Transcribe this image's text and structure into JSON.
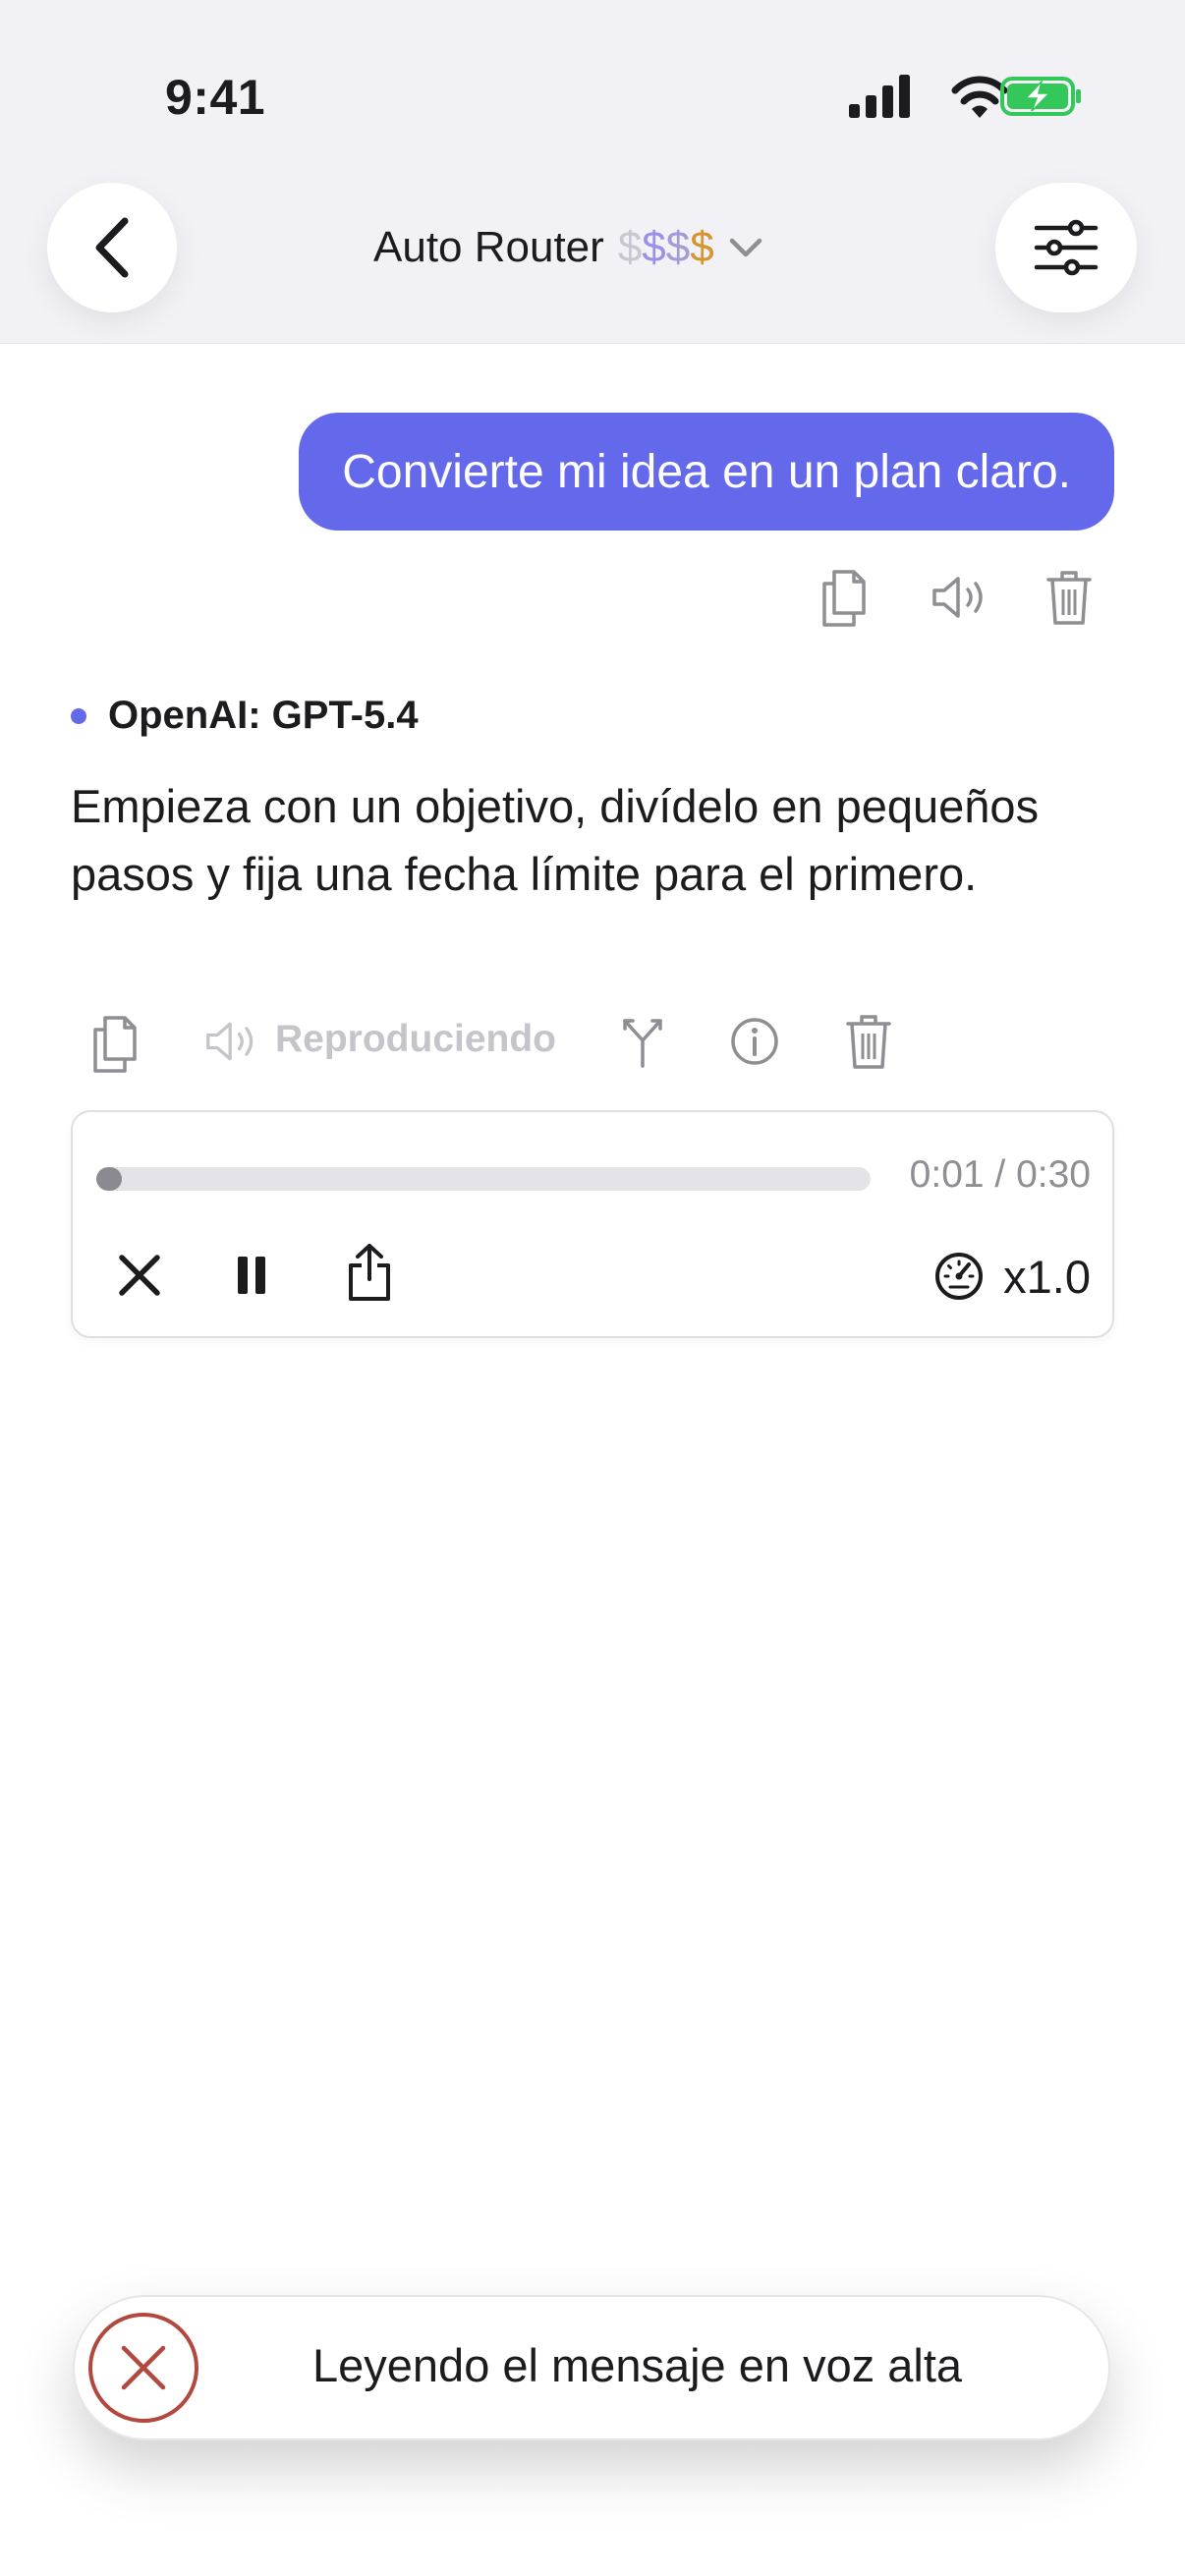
{
  "status_bar": {
    "time": "9:41"
  },
  "header": {
    "title": "Auto Router",
    "price_symbols": [
      "$",
      "$",
      "$",
      "$"
    ]
  },
  "conversation": {
    "user_message": "Convierte mi idea en un plan claro.",
    "model_name": "OpenAI: GPT-5.4",
    "assistant_message": "Empieza con un objetivo, divídelo en pequeños pasos y fija una fecha límite para el primero.",
    "playing_label": "Reproduciendo"
  },
  "player": {
    "progress_fraction": 0.033,
    "time_readout": "0:01 / 0:30",
    "speed": "x1.0"
  },
  "toast": {
    "text": "Leyendo el mensaje en voz alta"
  },
  "colors": {
    "accent": "#6469ec",
    "battery_green": "#34c759",
    "toast_red": "#b3483e"
  }
}
